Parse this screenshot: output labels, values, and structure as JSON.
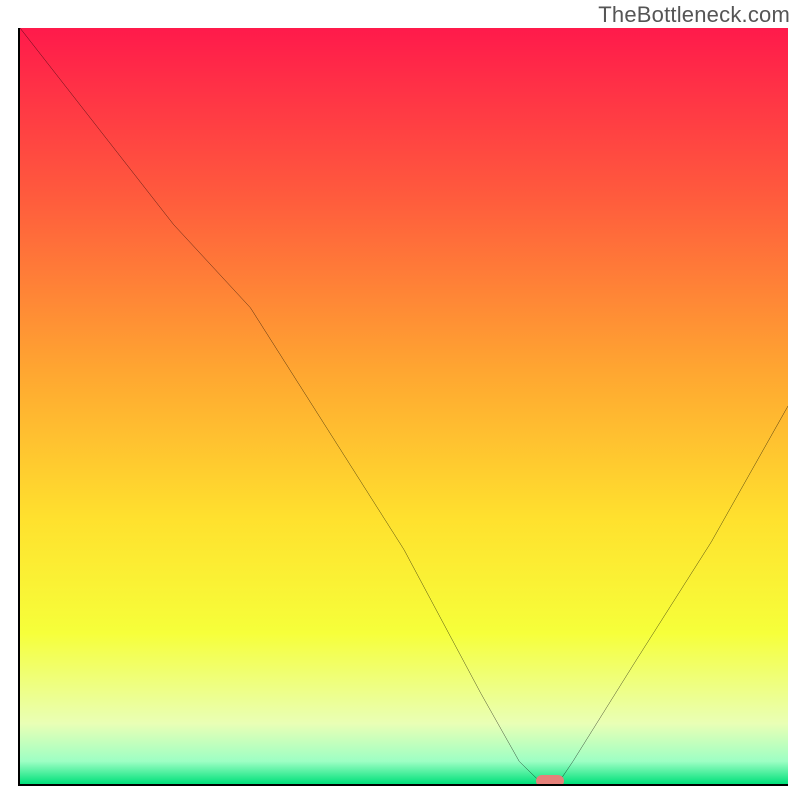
{
  "watermark": "TheBottleneck.com",
  "chart_data": {
    "type": "line",
    "title": "",
    "xlabel": "",
    "ylabel": "",
    "xlim": [
      0,
      100
    ],
    "ylim": [
      0,
      100
    ],
    "grid": false,
    "series": [
      {
        "name": "bottleneck-curve",
        "x": [
          0,
          10,
          20,
          30,
          40,
          50,
          60,
          65,
          68,
          70,
          72,
          80,
          90,
          100
        ],
        "values": [
          100,
          87,
          74,
          63,
          47,
          31,
          12,
          3,
          0,
          0,
          3,
          16,
          32,
          50
        ]
      }
    ],
    "marker": {
      "x": 69,
      "y": 0
    },
    "background_gradient": {
      "stops": [
        {
          "pct": 0,
          "color": "#ff1a4b"
        },
        {
          "pct": 22,
          "color": "#ff5a3d"
        },
        {
          "pct": 45,
          "color": "#ffa531"
        },
        {
          "pct": 65,
          "color": "#ffe12e"
        },
        {
          "pct": 80,
          "color": "#f6ff3a"
        },
        {
          "pct": 92,
          "color": "#e9ffb5"
        },
        {
          "pct": 97,
          "color": "#9dffc4"
        },
        {
          "pct": 100,
          "color": "#00e07a"
        }
      ]
    }
  }
}
